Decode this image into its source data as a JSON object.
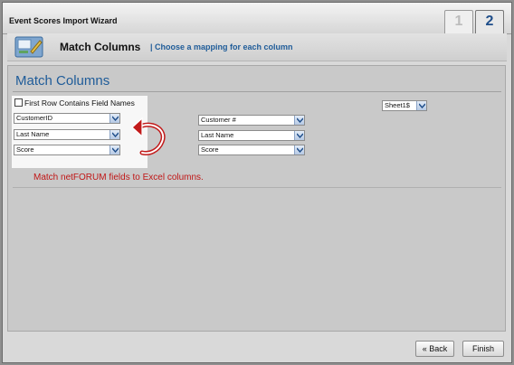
{
  "window": {
    "title": "Event Scores Import Wizard"
  },
  "steps": [
    "1",
    "2"
  ],
  "header": {
    "title": "Match Columns",
    "subtitle": "| Choose a mapping for each column"
  },
  "section": {
    "title": "Match Columns",
    "checkbox_label": "First Row Contains Field Names",
    "checkbox_checked": false,
    "sheet_select": "Sheet1$",
    "left_fields": [
      "CustomerID",
      "Last Name",
      "Score"
    ],
    "right_fields": [
      "Customer #",
      "Last Name",
      "Score"
    ],
    "note": "Match netFORUM fields to Excel columns."
  },
  "footer": {
    "back_label": "« Back",
    "finish_label": "Finish"
  },
  "icons": {
    "wizard": "wizard-icon",
    "dropdown": "chevron-down-icon",
    "arrow": "curved-arrow-icon"
  },
  "colors": {
    "accent": "#1f5c99",
    "note": "#c01616"
  }
}
